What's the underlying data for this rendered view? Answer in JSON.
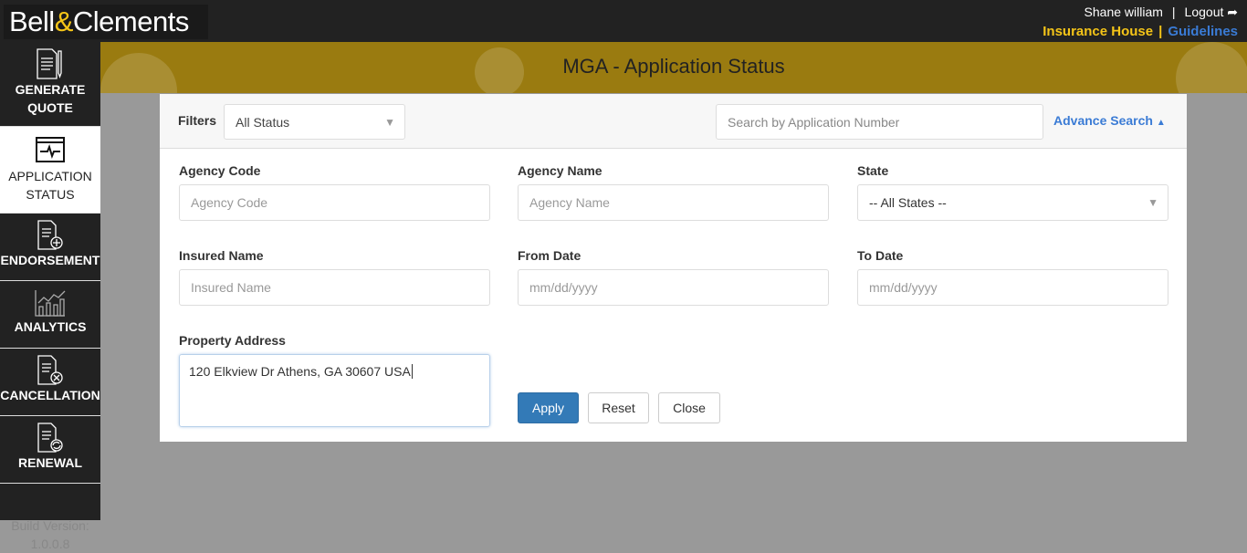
{
  "header": {
    "logo_left": "Bell",
    "logo_amp": "&",
    "logo_right": "Clements",
    "user": "Shane william",
    "sep": "|",
    "logout": "Logout",
    "insurance_house": "Insurance House",
    "guidelines": "Guidelines"
  },
  "sidebar": {
    "items": [
      {
        "label": "GENERATE QUOTE"
      },
      {
        "label": "APPLICATION STATUS"
      },
      {
        "label": "ENDORSEMENT"
      },
      {
        "label": "ANALYTICS"
      },
      {
        "label": "CANCELLATION"
      },
      {
        "label": "RENEWAL"
      }
    ],
    "build_label": "Build Version:",
    "build_version": "1.0.0.8"
  },
  "page": {
    "title": "MGA - Application Status"
  },
  "filters": {
    "label": "Filters",
    "status_value": "All Status",
    "search_placeholder": "Search by Application Number",
    "advance_search": "Advance Search"
  },
  "form": {
    "agency_code": {
      "label": "Agency Code",
      "placeholder": "Agency Code"
    },
    "agency_name": {
      "label": "Agency Name",
      "placeholder": "Agency Name"
    },
    "state": {
      "label": "State",
      "value": "-- All States --"
    },
    "insured_name": {
      "label": "Insured Name",
      "placeholder": "Insured Name"
    },
    "from_date": {
      "label": "From Date",
      "placeholder": "mm/dd/yyyy"
    },
    "to_date": {
      "label": "To Date",
      "placeholder": "mm/dd/yyyy"
    },
    "property_address": {
      "label": "Property Address",
      "value": "120 Elkview Dr Athens, GA 30607 USA"
    }
  },
  "buttons": {
    "apply": "Apply",
    "reset": "Reset",
    "close": "Close"
  }
}
